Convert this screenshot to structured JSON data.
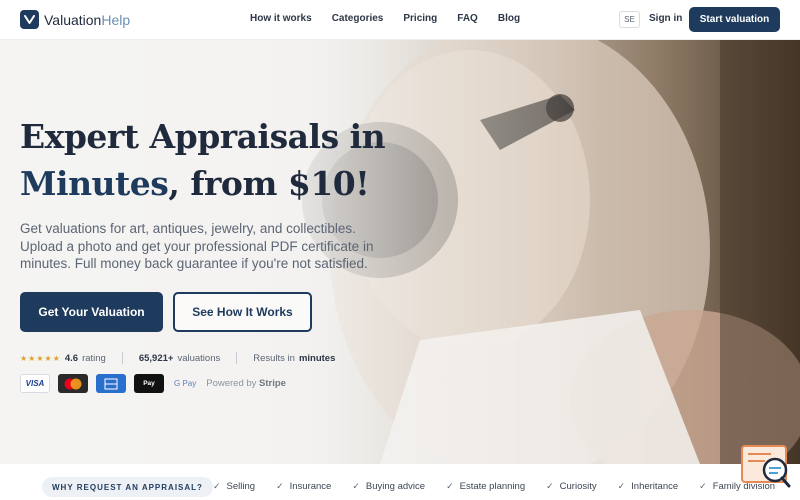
{
  "header": {
    "logo_main": "Valuation",
    "logo_accent": "Help",
    "nav": [
      "How it works",
      "Categories",
      "Pricing",
      "FAQ",
      "Blog"
    ],
    "lang": "SE",
    "signin": "Sign in",
    "cta": "Start valuation"
  },
  "hero": {
    "headline_line1": "Expert Appraisals in",
    "headline_blue": "Minutes",
    "headline_rest": ", from $10!",
    "subtext": "Get valuations for art, antiques, jewelry, and collectibles. Upload a photo and get your professional PDF certificate in minutes. Full money back guarantee if you're not satisfied.",
    "primary_button": "Get Your Valuation",
    "secondary_button": "See How It Works"
  },
  "stats": {
    "stars": "★★★★★",
    "rating_value": "4.6",
    "rating_label": "rating",
    "valuations_count": "65,921+",
    "valuations_label": "valuations",
    "results_prefix": "Results in",
    "results_value": "minutes"
  },
  "payments": {
    "visa": "VISA",
    "apple": " Pay",
    "gpay": "G Pay",
    "powered_prefix": "Powered by",
    "powered_brand": "Stripe"
  },
  "reasons": {
    "label": "WHY REQUEST AN APPRAISAL?",
    "items": [
      "Selling",
      "Insurance",
      "Buying advice",
      "Estate planning",
      "Curiosity",
      "Inheritance",
      "Family division"
    ]
  },
  "colors": {
    "brand": "#1e3a5c",
    "star": "#e0a12b"
  }
}
